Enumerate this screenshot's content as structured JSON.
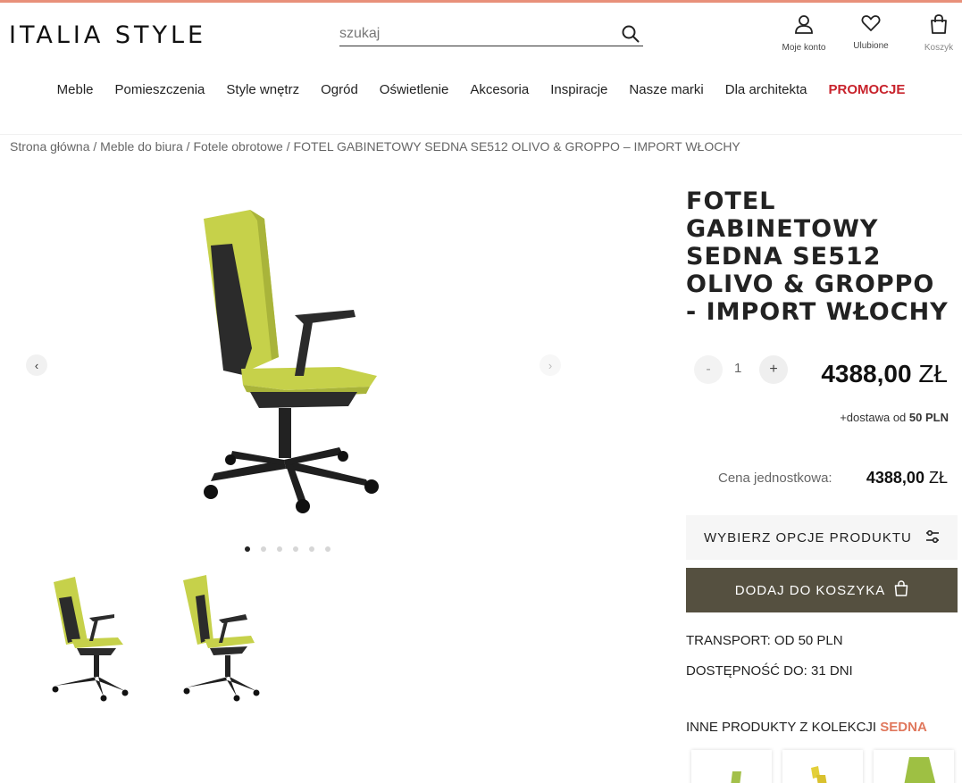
{
  "brand": {
    "logo": "ITALIA STYLE"
  },
  "search": {
    "placeholder": "szukaj"
  },
  "header_icons": [
    {
      "label": "Moje konto",
      "icon": "user-icon"
    },
    {
      "label": "Ulubione",
      "icon": "heart-icon"
    },
    {
      "label": "Koszyk",
      "icon": "bag-icon"
    }
  ],
  "nav": [
    "Meble",
    "Pomieszczenia",
    "Style wnętrz",
    "Ogród",
    "Oświetlenie",
    "Akcesoria",
    "Inspiracje",
    "Nasze marki",
    "Dla architekta",
    "PROMOCJE"
  ],
  "breadcrumb": "Strona główna / Meble do biura / Fotele obrotowe / FOTEL GABINETOWY SEDNA SE512 OLIVO & GROPPO – IMPORT WŁOCHY",
  "product": {
    "title": "FOTEL GABINETOWY SEDNA SE512 OLIVO & GROPPO - IMPORT WŁOCHY",
    "quantity": "1",
    "qty_minus": "-",
    "qty_plus": "+",
    "price": "4388,00",
    "currency": "ZŁ",
    "delivery_prefix": "+dostawa od",
    "delivery_value": "50 PLN",
    "unit_price_label": "Cena jednostkowa:",
    "unit_price": "4388,00",
    "options_button": "WYBIERZ OPCJE PRODUKTU",
    "cart_button": "DODAJ DO KOSZYKA",
    "transport": "TRANSPORT: OD 50 PLN",
    "availability": "DOSTĘPNOŚĆ DO: 31 DNI"
  },
  "gallery": {
    "prev": "‹",
    "next": "›",
    "slide_count": 6,
    "active_slide": 1
  },
  "collection": {
    "title_prefix": "INNE PRODUKTY Z KOLEKCJI",
    "collection_name": "SEDNA"
  },
  "colors": {
    "accent_line": "#e8907a",
    "promo": "#c8232c",
    "cart_button": "#555040",
    "chair_fabric": "#c6d14a",
    "collection_accent": "#e0785d"
  }
}
